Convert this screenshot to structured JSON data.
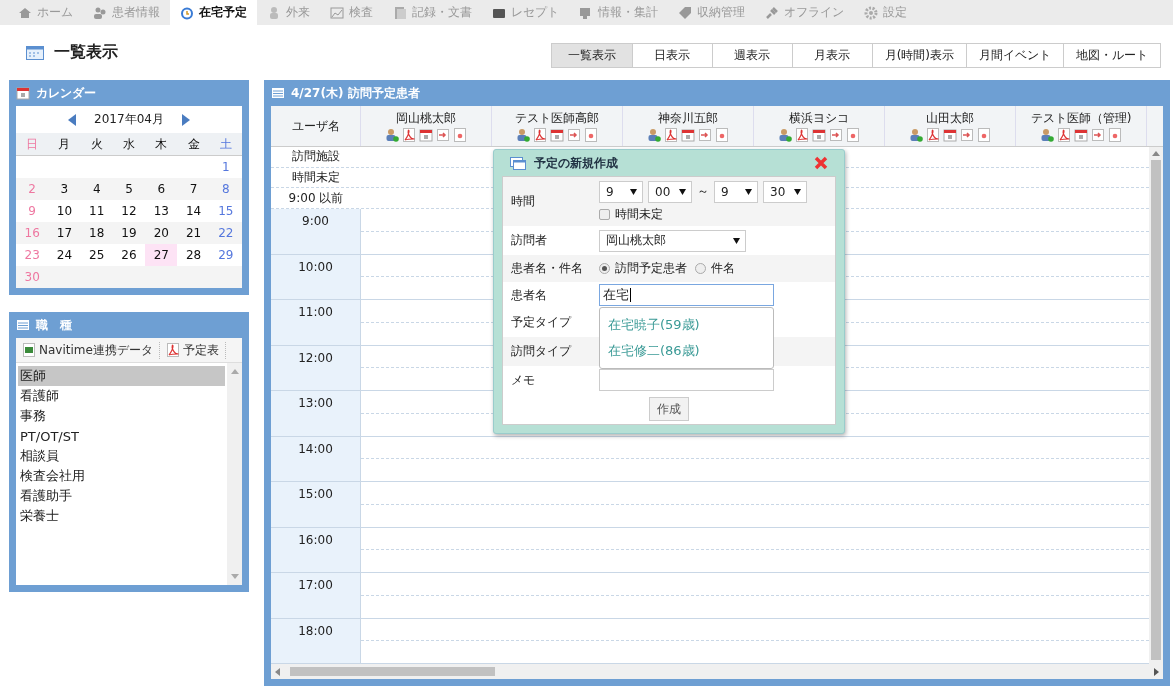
{
  "nav": {
    "tabs": [
      {
        "label": "ホーム",
        "selected": false
      },
      {
        "label": "患者情報",
        "selected": false
      },
      {
        "label": "在宅予定",
        "selected": true
      },
      {
        "label": "外来",
        "selected": false
      },
      {
        "label": "検査",
        "selected": false
      },
      {
        "label": "記録・文書",
        "selected": false
      },
      {
        "label": "レセプト",
        "selected": false
      },
      {
        "label": "情報・集計",
        "selected": false
      },
      {
        "label": "収納管理",
        "selected": false
      },
      {
        "label": "オフライン",
        "selected": false
      },
      {
        "label": "設定",
        "selected": false
      }
    ]
  },
  "page_title": "一覧表示",
  "view_tabs": [
    {
      "label": "一覧表示",
      "selected": true
    },
    {
      "label": "日表示",
      "selected": false
    },
    {
      "label": "週表示",
      "selected": false
    },
    {
      "label": "月表示",
      "selected": false
    },
    {
      "label": "月(時間)表示",
      "selected": false
    },
    {
      "label": "月間イベント",
      "selected": false
    },
    {
      "label": "地図・ルート",
      "selected": false
    }
  ],
  "calendar": {
    "title": "カレンダー",
    "month": "2017年04月",
    "weekdays": [
      "日",
      "月",
      "火",
      "水",
      "木",
      "金",
      "土"
    ],
    "weeks": [
      [
        {
          "label": "1",
          "selected": false
        }
      ],
      [
        {
          "label": "2",
          "selected": false
        },
        {
          "label": "3",
          "selected": false
        },
        {
          "label": "4",
          "selected": false
        },
        {
          "label": "5",
          "selected": false
        },
        {
          "label": "6",
          "selected": false
        },
        {
          "label": "7",
          "selected": false
        },
        {
          "label": "8",
          "selected": false
        }
      ],
      [
        {
          "label": "9",
          "selected": false
        },
        {
          "label": "10",
          "selected": false
        },
        {
          "label": "11",
          "selected": false
        },
        {
          "label": "12",
          "selected": false
        },
        {
          "label": "13",
          "selected": false
        },
        {
          "label": "14",
          "selected": false
        },
        {
          "label": "15",
          "selected": false
        }
      ],
      [
        {
          "label": "16",
          "selected": false
        },
        {
          "label": "17",
          "selected": false
        },
        {
          "label": "18",
          "selected": false
        },
        {
          "label": "19",
          "selected": false
        },
        {
          "label": "20",
          "selected": false
        },
        {
          "label": "21",
          "selected": false
        },
        {
          "label": "22",
          "selected": false
        }
      ],
      [
        {
          "label": "23",
          "selected": false
        },
        {
          "label": "24",
          "selected": false
        },
        {
          "label": "25",
          "selected": false
        },
        {
          "label": "26",
          "selected": false
        },
        {
          "label": "27",
          "selected": true
        },
        {
          "label": "28",
          "selected": false
        },
        {
          "label": "29",
          "selected": false
        }
      ],
      [
        {
          "label": "30",
          "selected": false
        }
      ]
    ]
  },
  "job_types": {
    "title": "職　種",
    "toolbar": [
      {
        "kind": "excel",
        "label": "Navitime連携データ"
      },
      {
        "kind": "pdf",
        "label": "予定表"
      }
    ],
    "items": [
      {
        "label": "医師",
        "selected": true
      },
      {
        "label": "看護師",
        "selected": false
      },
      {
        "label": "事務",
        "selected": false
      },
      {
        "label": "PT/OT/ST",
        "selected": false
      },
      {
        "label": "相談員",
        "selected": false
      },
      {
        "label": "検査会社用",
        "selected": false
      },
      {
        "label": "看護助手",
        "selected": false
      },
      {
        "label": "栄養士",
        "selected": false
      }
    ]
  },
  "schedule": {
    "title": "4/27(木) 訪問予定患者",
    "user_header": "ユーザ名",
    "users": [
      "岡山桃太郎",
      "テスト医師高郎",
      "神奈川五郎",
      "横浜ヨシコ",
      "山田太郎",
      "テスト医師（管理)"
    ],
    "special_rows": [
      "訪問施設",
      "時間未定",
      "9:00 以前"
    ],
    "hours": [
      "9:00",
      "10:00",
      "11:00",
      "12:00",
      "13:00",
      "14:00",
      "15:00",
      "16:00",
      "17:00",
      "18:00"
    ]
  },
  "dialog": {
    "title": "予定の新規作成",
    "time": {
      "label": "時間",
      "start_hour": "9",
      "start_minute": "00",
      "separator": "～",
      "end_hour": "9",
      "end_minute": "30",
      "undecided": {
        "label": "時間未定",
        "checked": false
      }
    },
    "visitor": {
      "label": "訪問者",
      "value": "岡山桃太郎"
    },
    "name_type": {
      "label": "患者名・件名",
      "options": [
        {
          "label": "訪問予定患者",
          "selected": true
        },
        {
          "label": "件名",
          "selected": false
        }
      ]
    },
    "patient": {
      "label": "患者名",
      "value": "在宅",
      "suggestions": [
        "在宅暁子(59歳)",
        "在宅修二(86歳)"
      ]
    },
    "schedule_type": {
      "label": "予定タイプ"
    },
    "visit_type": {
      "label": "訪問タイプ"
    },
    "memo": {
      "label": "メモ"
    },
    "submit": "作成"
  }
}
